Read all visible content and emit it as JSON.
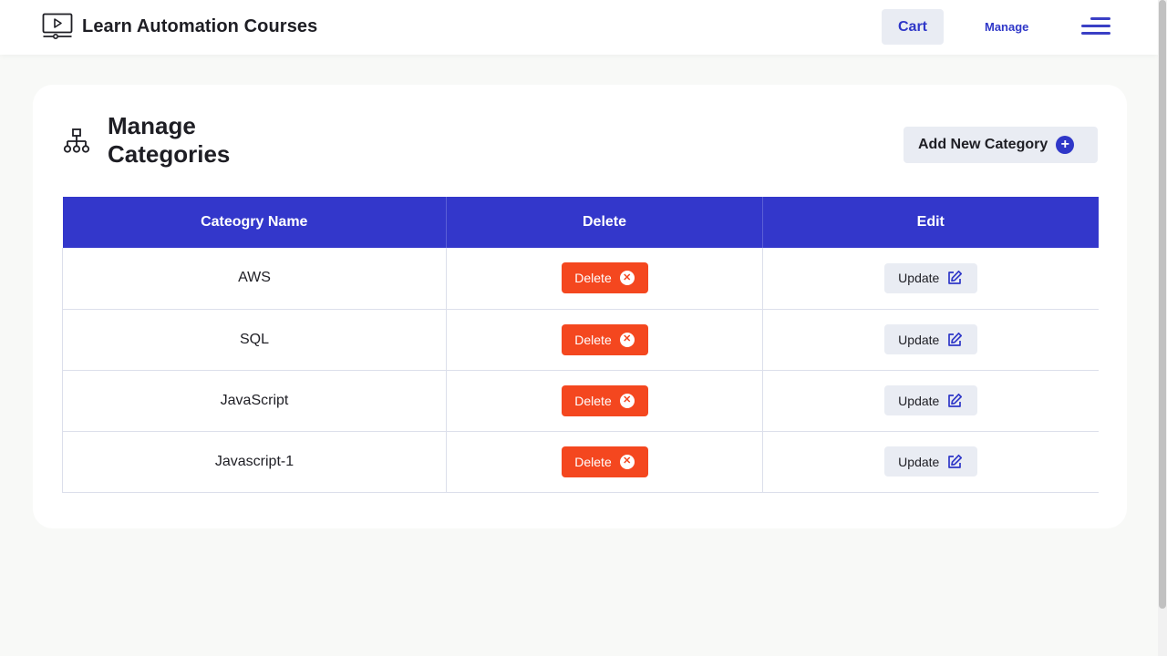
{
  "header": {
    "brand_title": "Learn Automation Courses",
    "cart_label": "Cart",
    "manage_label": "Manage"
  },
  "card": {
    "title": "Manage Categories",
    "add_button_label": "Add New Category"
  },
  "table": {
    "columns": [
      "Cateogry Name",
      "Delete",
      "Edit"
    ],
    "rows": [
      {
        "name": "AWS",
        "delete_label": "Delete",
        "update_label": "Update"
      },
      {
        "name": "SQL",
        "delete_label": "Delete",
        "update_label": "Update"
      },
      {
        "name": "JavaScript",
        "delete_label": "Delete",
        "update_label": "Update"
      },
      {
        "name": "Javascript-1",
        "delete_label": "Delete",
        "update_label": "Update"
      }
    ]
  },
  "icons": {
    "brand": "video-player-icon",
    "menu": "hamburger-menu-icon",
    "card_head": "category-tree-icon",
    "add": "plus-circle-icon",
    "delete": "x-circle-icon",
    "update": "edit-icon"
  },
  "colors": {
    "accent": "#3337cb",
    "delete": "#f4471f",
    "button_bg": "#e9ecf3",
    "page_bg": "#f8f9f7"
  }
}
